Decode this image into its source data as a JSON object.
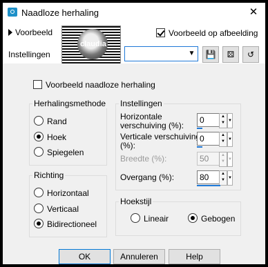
{
  "window": {
    "title": "Naadloze herhaling",
    "close_glyph": "✕"
  },
  "top": {
    "preview_toggle": "Voorbeeld",
    "thumbnail_watermark": "claudia",
    "preview_on_image": {
      "label": "Voorbeeld op afbeelding",
      "checked": true
    },
    "settings_label": "Instellingen",
    "settings_value": "",
    "tool_icons": [
      "save-icon",
      "random-dice-icon",
      "reset-icon"
    ]
  },
  "seamless_preview": {
    "label": "Voorbeeld naadloze herhaling",
    "checked": false
  },
  "repeat_method": {
    "title": "Herhalingsmethode",
    "options": [
      {
        "label": "Rand",
        "selected": false
      },
      {
        "label": "Hoek",
        "selected": true
      },
      {
        "label": "Spiegelen",
        "selected": false
      }
    ]
  },
  "direction": {
    "title": "Richting",
    "options": [
      {
        "label": "Horizontaal",
        "selected": false
      },
      {
        "label": "Verticaal",
        "selected": false
      },
      {
        "label": "Bidirectioneel",
        "selected": true
      }
    ]
  },
  "settings": {
    "title": "Instellingen",
    "h_shift": {
      "label_1": "Horizontale",
      "label_2": "verschuiving (%):",
      "value": "0"
    },
    "v_shift": {
      "label_1": "Verticale verschuiving",
      "label_2": "(%):",
      "value": "0"
    },
    "width": {
      "label": "Breedte (%):",
      "value": "50",
      "enabled": false
    },
    "transition": {
      "label": "Overgang (%):",
      "value": "80"
    }
  },
  "corner_style": {
    "title": "Hoekstijl",
    "options": [
      {
        "label": "Lineair",
        "selected": false
      },
      {
        "label": "Gebogen",
        "selected": true
      }
    ]
  },
  "buttons": {
    "ok": "OK",
    "cancel": "Annuleren",
    "help": "Help"
  }
}
